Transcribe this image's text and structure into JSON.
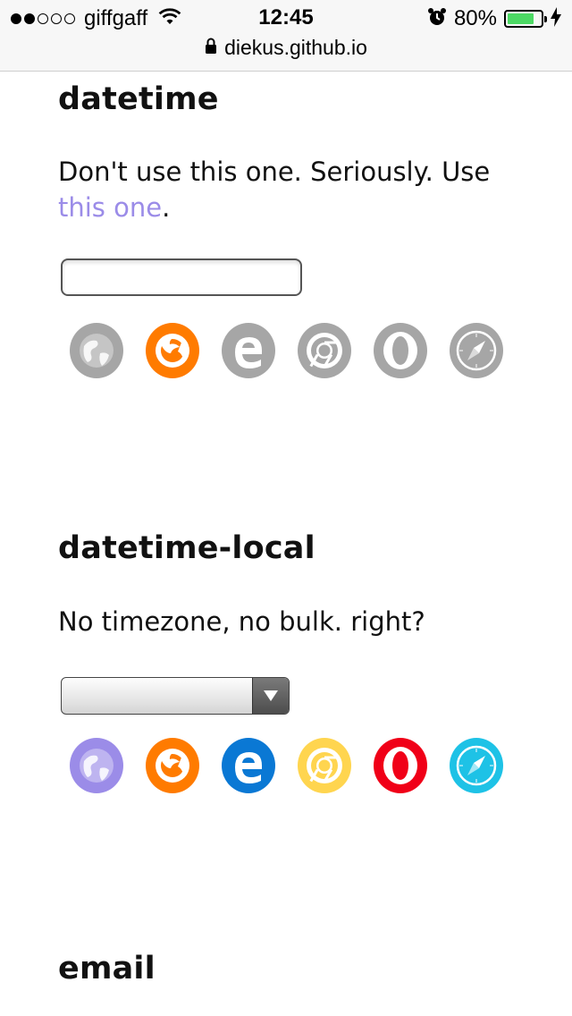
{
  "status_bar": {
    "carrier": "giffgaff",
    "signal_bars_filled": 2,
    "signal_bars_total": 5,
    "time": "12:45",
    "battery_percent": "80%",
    "battery_level": 0.8,
    "url": "diekus.github.io",
    "icons": [
      "wifi-icon",
      "lock-icon",
      "alarm-icon",
      "battery-icon",
      "charging-bolt-icon"
    ]
  },
  "colors": {
    "disabled_gray": "#a6a6a6",
    "link": "#9b8ce8",
    "generic_browser": "#9b8ce8",
    "firefox": "#ff7b00",
    "edge": "#0a78d4",
    "chrome": "#ffd54f",
    "opera": "#f00018",
    "safari": "#1ec2e6",
    "battery_green": "#4cd964"
  },
  "sections": [
    {
      "title": "datetime",
      "description_before": "Don't use this one. Seriously. Use",
      "link_text": "this one",
      "description_after": ".",
      "input_type": "text-field",
      "browsers": [
        {
          "name": "generic",
          "supported": false
        },
        {
          "name": "firefox",
          "supported": true
        },
        {
          "name": "edge",
          "supported": false
        },
        {
          "name": "chrome",
          "supported": false
        },
        {
          "name": "opera",
          "supported": false
        },
        {
          "name": "safari",
          "supported": false
        }
      ]
    },
    {
      "title": "datetime-local",
      "description_before": "No timezone, no bulk. right?",
      "input_type": "select",
      "browsers": [
        {
          "name": "generic",
          "supported": true
        },
        {
          "name": "firefox",
          "supported": true
        },
        {
          "name": "edge",
          "supported": true
        },
        {
          "name": "chrome",
          "supported": true
        },
        {
          "name": "opera",
          "supported": true
        },
        {
          "name": "safari",
          "supported": true
        }
      ]
    },
    {
      "title": "email"
    }
  ]
}
